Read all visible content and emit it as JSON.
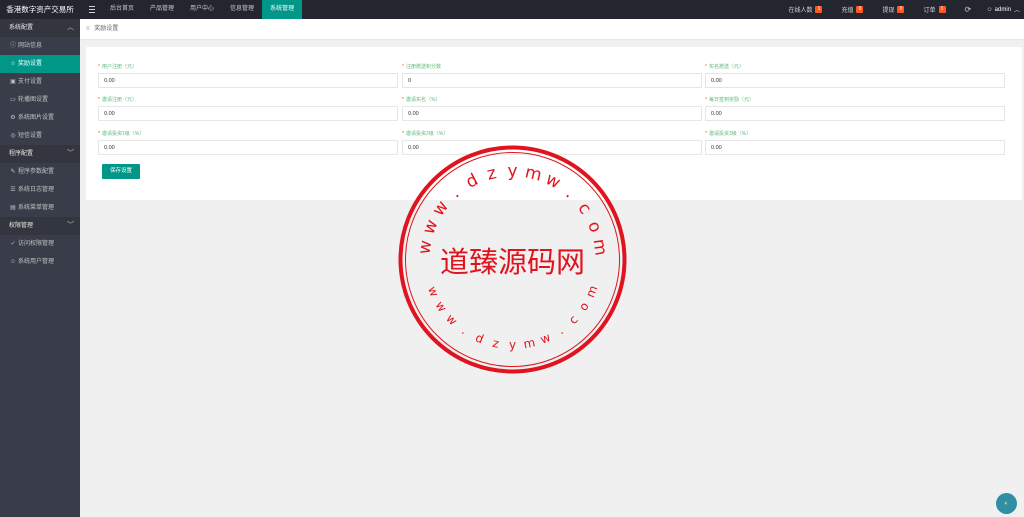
{
  "app": {
    "brand": "香港数字资产交易所"
  },
  "nav": [
    {
      "label": "后台首页"
    },
    {
      "label": "产品管理"
    },
    {
      "label": "用户中心"
    },
    {
      "label": "信息管理"
    },
    {
      "label": "系统管理"
    }
  ],
  "stats": [
    {
      "label": "在线人数",
      "count": "1"
    },
    {
      "label": "充值",
      "count": "0"
    },
    {
      "label": "提现",
      "count": "0"
    },
    {
      "label": "订单",
      "count": "1"
    }
  ],
  "user": {
    "name": "admin"
  },
  "sidebar": {
    "groups": [
      {
        "label": "系统配置",
        "items": [
          {
            "label": "网站信息",
            "icon": "info-icon"
          },
          {
            "label": "奖励设置",
            "icon": "gift-icon"
          },
          {
            "label": "支付设置",
            "icon": "payment-icon"
          },
          {
            "label": "轮播图设置",
            "icon": "image-icon"
          },
          {
            "label": "系统图片设置",
            "icon": "gear-icon"
          },
          {
            "label": "短信设置",
            "icon": "sms-icon"
          }
        ]
      },
      {
        "label": "程序配置",
        "items": [
          {
            "label": "程序参数配置",
            "icon": "wrench-icon"
          },
          {
            "label": "系统日志管理",
            "icon": "log-icon"
          },
          {
            "label": "系统菜单管理",
            "icon": "menu-icon"
          }
        ]
      },
      {
        "label": "权限管理",
        "items": [
          {
            "label": "访问权限管理",
            "icon": "check-circle-icon"
          },
          {
            "label": "系统用户管理",
            "icon": "user-icon"
          }
        ]
      }
    ]
  },
  "breadcrumb": {
    "current": "奖励设置"
  },
  "form": {
    "fields": [
      {
        "label": "用户注册（元）",
        "value": "0.00"
      },
      {
        "label": "注册赠送积分数",
        "value": "0"
      },
      {
        "label": "实名赠送（元）",
        "value": "0.00"
      },
      {
        "label": "邀请注册（元）",
        "value": "0.00"
      },
      {
        "label": "邀请实名（%）",
        "value": "0.00"
      },
      {
        "label": "每日签到奖励（元）",
        "value": "0.00"
      },
      {
        "label": "邀请投资1级（%）",
        "value": "0.00"
      },
      {
        "label": "邀请投资2级（%）",
        "value": "0.00"
      },
      {
        "label": "邀请投资3级（%）",
        "value": "0.00"
      }
    ],
    "save_label": "保存设置"
  },
  "watermark": {
    "center_text": "道臻源码网",
    "ring_text": "www.dzymw.com",
    "color": "#e0141e"
  },
  "colors": {
    "accent": "#009688",
    "badge": "#ff5722",
    "topbar": "#23262e",
    "sidebar": "#393d49"
  }
}
